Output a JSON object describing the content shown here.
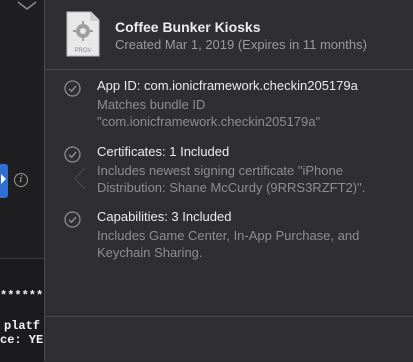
{
  "console": {
    "lines": [
      "*********",
      "platf",
      "ce: YE"
    ]
  },
  "profile": {
    "icon_label": "PROV",
    "title": "Coffee Bunker Kiosks",
    "created": "Created Mar 1, 2019 (Expires in 11 months)"
  },
  "items": [
    {
      "heading": "App ID: com.ionicframework.checkin205179a",
      "description": "Matches bundle ID \"com.ionicframework.checkin205179a\""
    },
    {
      "heading": "Certificates: 1 Included",
      "description": "Includes newest signing certificate \"iPhone Distribution: Shane McCurdy (9RRS3RZFT2)\"."
    },
    {
      "heading": "Capabilities: 3 Included",
      "description": "Includes Game Center, In-App Purchase, and Keychain Sharing."
    }
  ],
  "colors": {
    "check": "#8e8e92",
    "accent": "#2f6fd0"
  },
  "icons": [
    "info-icon",
    "check-circle-icon",
    "provisioning-file-icon"
  ]
}
